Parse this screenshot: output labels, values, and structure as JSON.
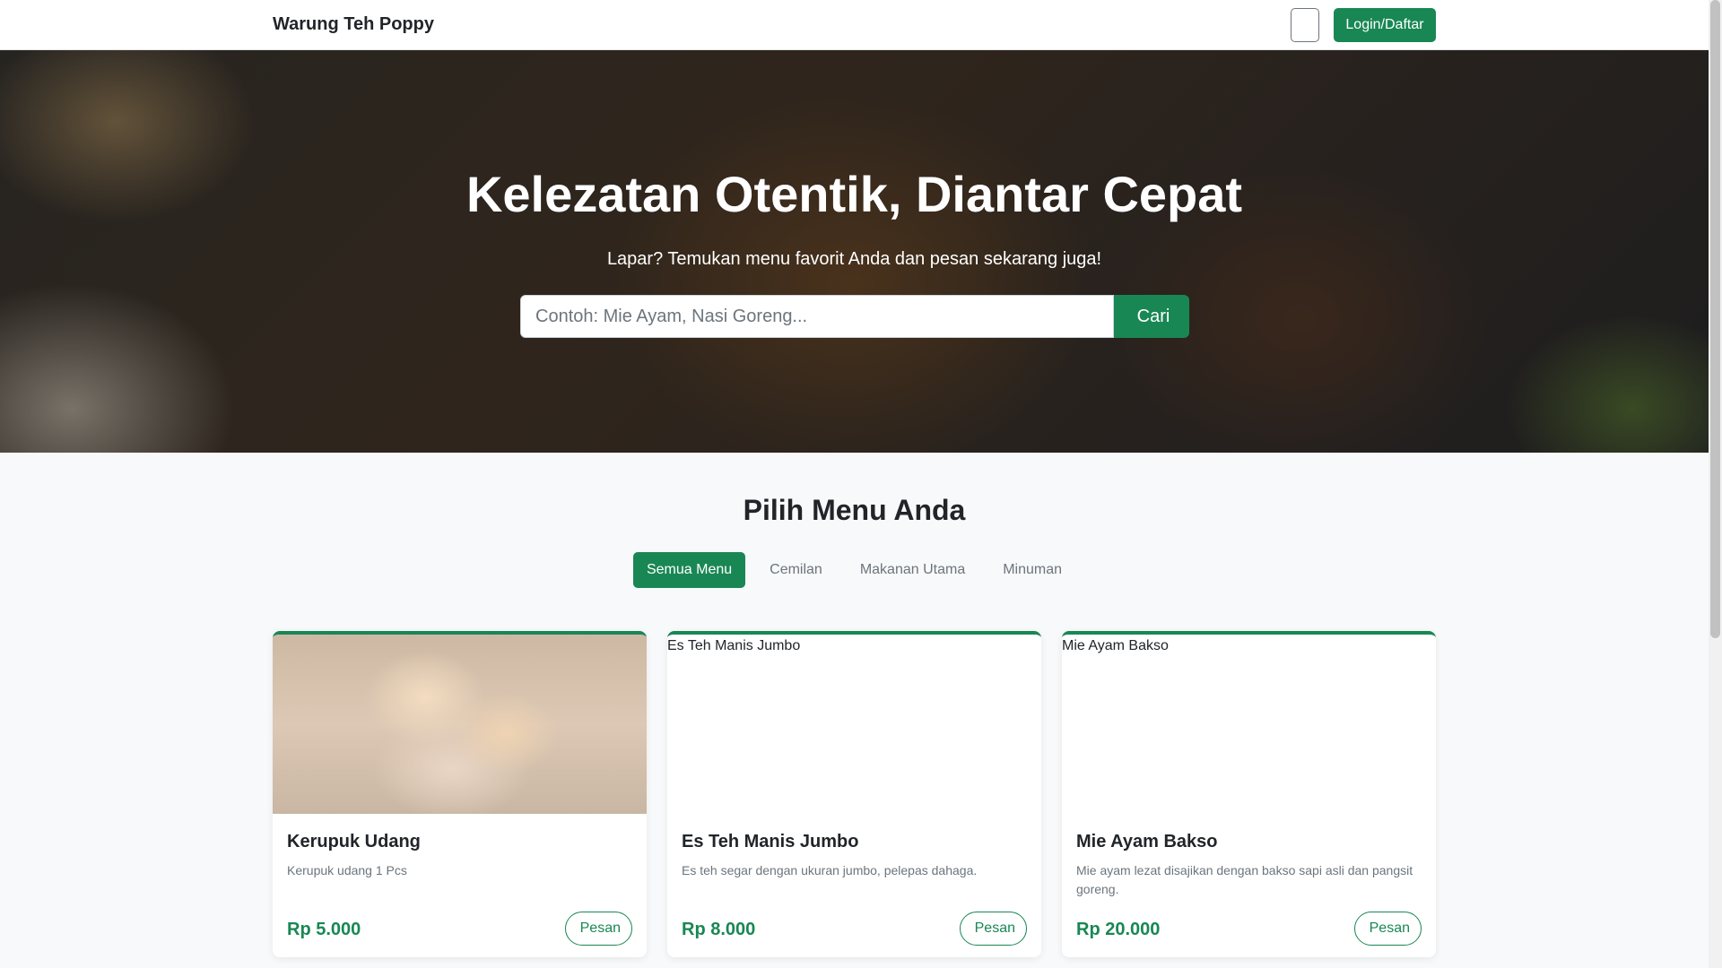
{
  "navbar": {
    "brand": "Warung Teh Poppy",
    "toggler_icon": "",
    "login_label": "Login/Daftar"
  },
  "hero": {
    "title": "Kelezatan Otentik, Diantar Cepat",
    "subtitle": "Lapar? Temukan menu favorit Anda dan pesan sekarang juga!",
    "search_placeholder": "Contoh: Mie Ayam, Nasi Goreng...",
    "search_icon": "",
    "search_label": "Cari"
  },
  "menu": {
    "title": "Pilih Menu Anda",
    "filters": [
      {
        "label": "Semua Menu",
        "active": true
      },
      {
        "label": "Cemilan",
        "active": false
      },
      {
        "label": "Makanan Utama",
        "active": false
      },
      {
        "label": "Minuman",
        "active": false
      }
    ],
    "items": [
      {
        "image_alt": "",
        "name": "Kerupuk Udang",
        "description": "Kerupuk udang 1 Pcs",
        "price": "Rp 5.000",
        "order_icon": "",
        "order_label": "Pesan"
      },
      {
        "image_alt": "Es Teh Manis Jumbo",
        "name": "Es Teh Manis Jumbo",
        "description": "Es teh segar dengan ukuran jumbo, pelepas dahaga.",
        "price": "Rp 8.000",
        "order_icon": "",
        "order_label": "Pesan"
      },
      {
        "image_alt": "Mie Ayam Bakso",
        "name": "Mie Ayam Bakso",
        "description": "Mie ayam lezat disajikan dengan bakso sapi asli dan pangsit goreng.",
        "price": "Rp 20.000",
        "order_icon": "",
        "order_label": "Pesan"
      }
    ]
  },
  "colors": {
    "accent": "#198754",
    "text": "#212529",
    "muted": "#6c757d",
    "background": "#f8f9fa"
  }
}
